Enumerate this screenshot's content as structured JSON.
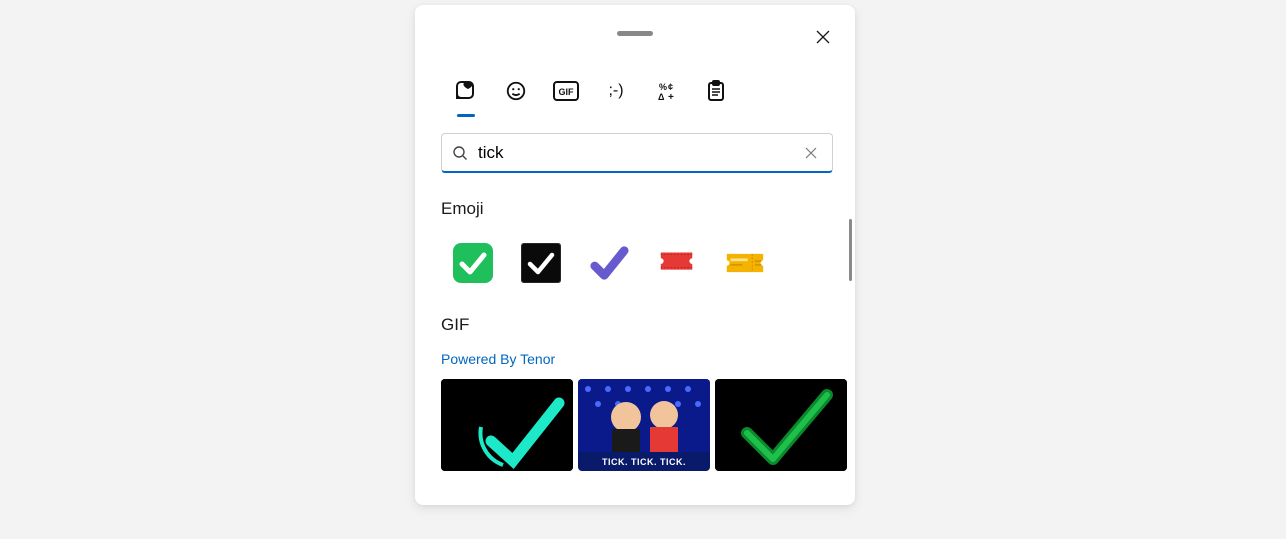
{
  "search": {
    "value": "tick",
    "placeholder": "Search"
  },
  "tabs": {
    "items": [
      "sticker-heart",
      "smiley",
      "gif",
      "kaomoji",
      "symbols",
      "clipboard"
    ],
    "activeIndex": 0
  },
  "emoji": {
    "heading": "Emoji",
    "items": [
      {
        "name": "check-mark-button-green",
        "color_bg": "#22c55e",
        "color_fg": "#fff"
      },
      {
        "name": "check-box-black",
        "color_bg": "#0a0a0a",
        "color_fg": "#fff"
      },
      {
        "name": "heavy-check-mark-purple",
        "color_bg": "transparent",
        "color_fg": "#6c5dd3"
      },
      {
        "name": "admission-tickets-red",
        "color_bg": "transparent",
        "color_fg": "#e53935"
      },
      {
        "name": "ticket-yellow",
        "color_bg": "transparent",
        "color_fg": "#f5b301"
      }
    ]
  },
  "gif": {
    "heading": "GIF",
    "powered_by": "Powered By Tenor",
    "items": [
      {
        "name": "teal-check-gif",
        "caption": ""
      },
      {
        "name": "tick-tick-tick-gif",
        "caption": "TICK. TICK. TICK."
      },
      {
        "name": "green-check-gif",
        "caption": ""
      }
    ]
  }
}
